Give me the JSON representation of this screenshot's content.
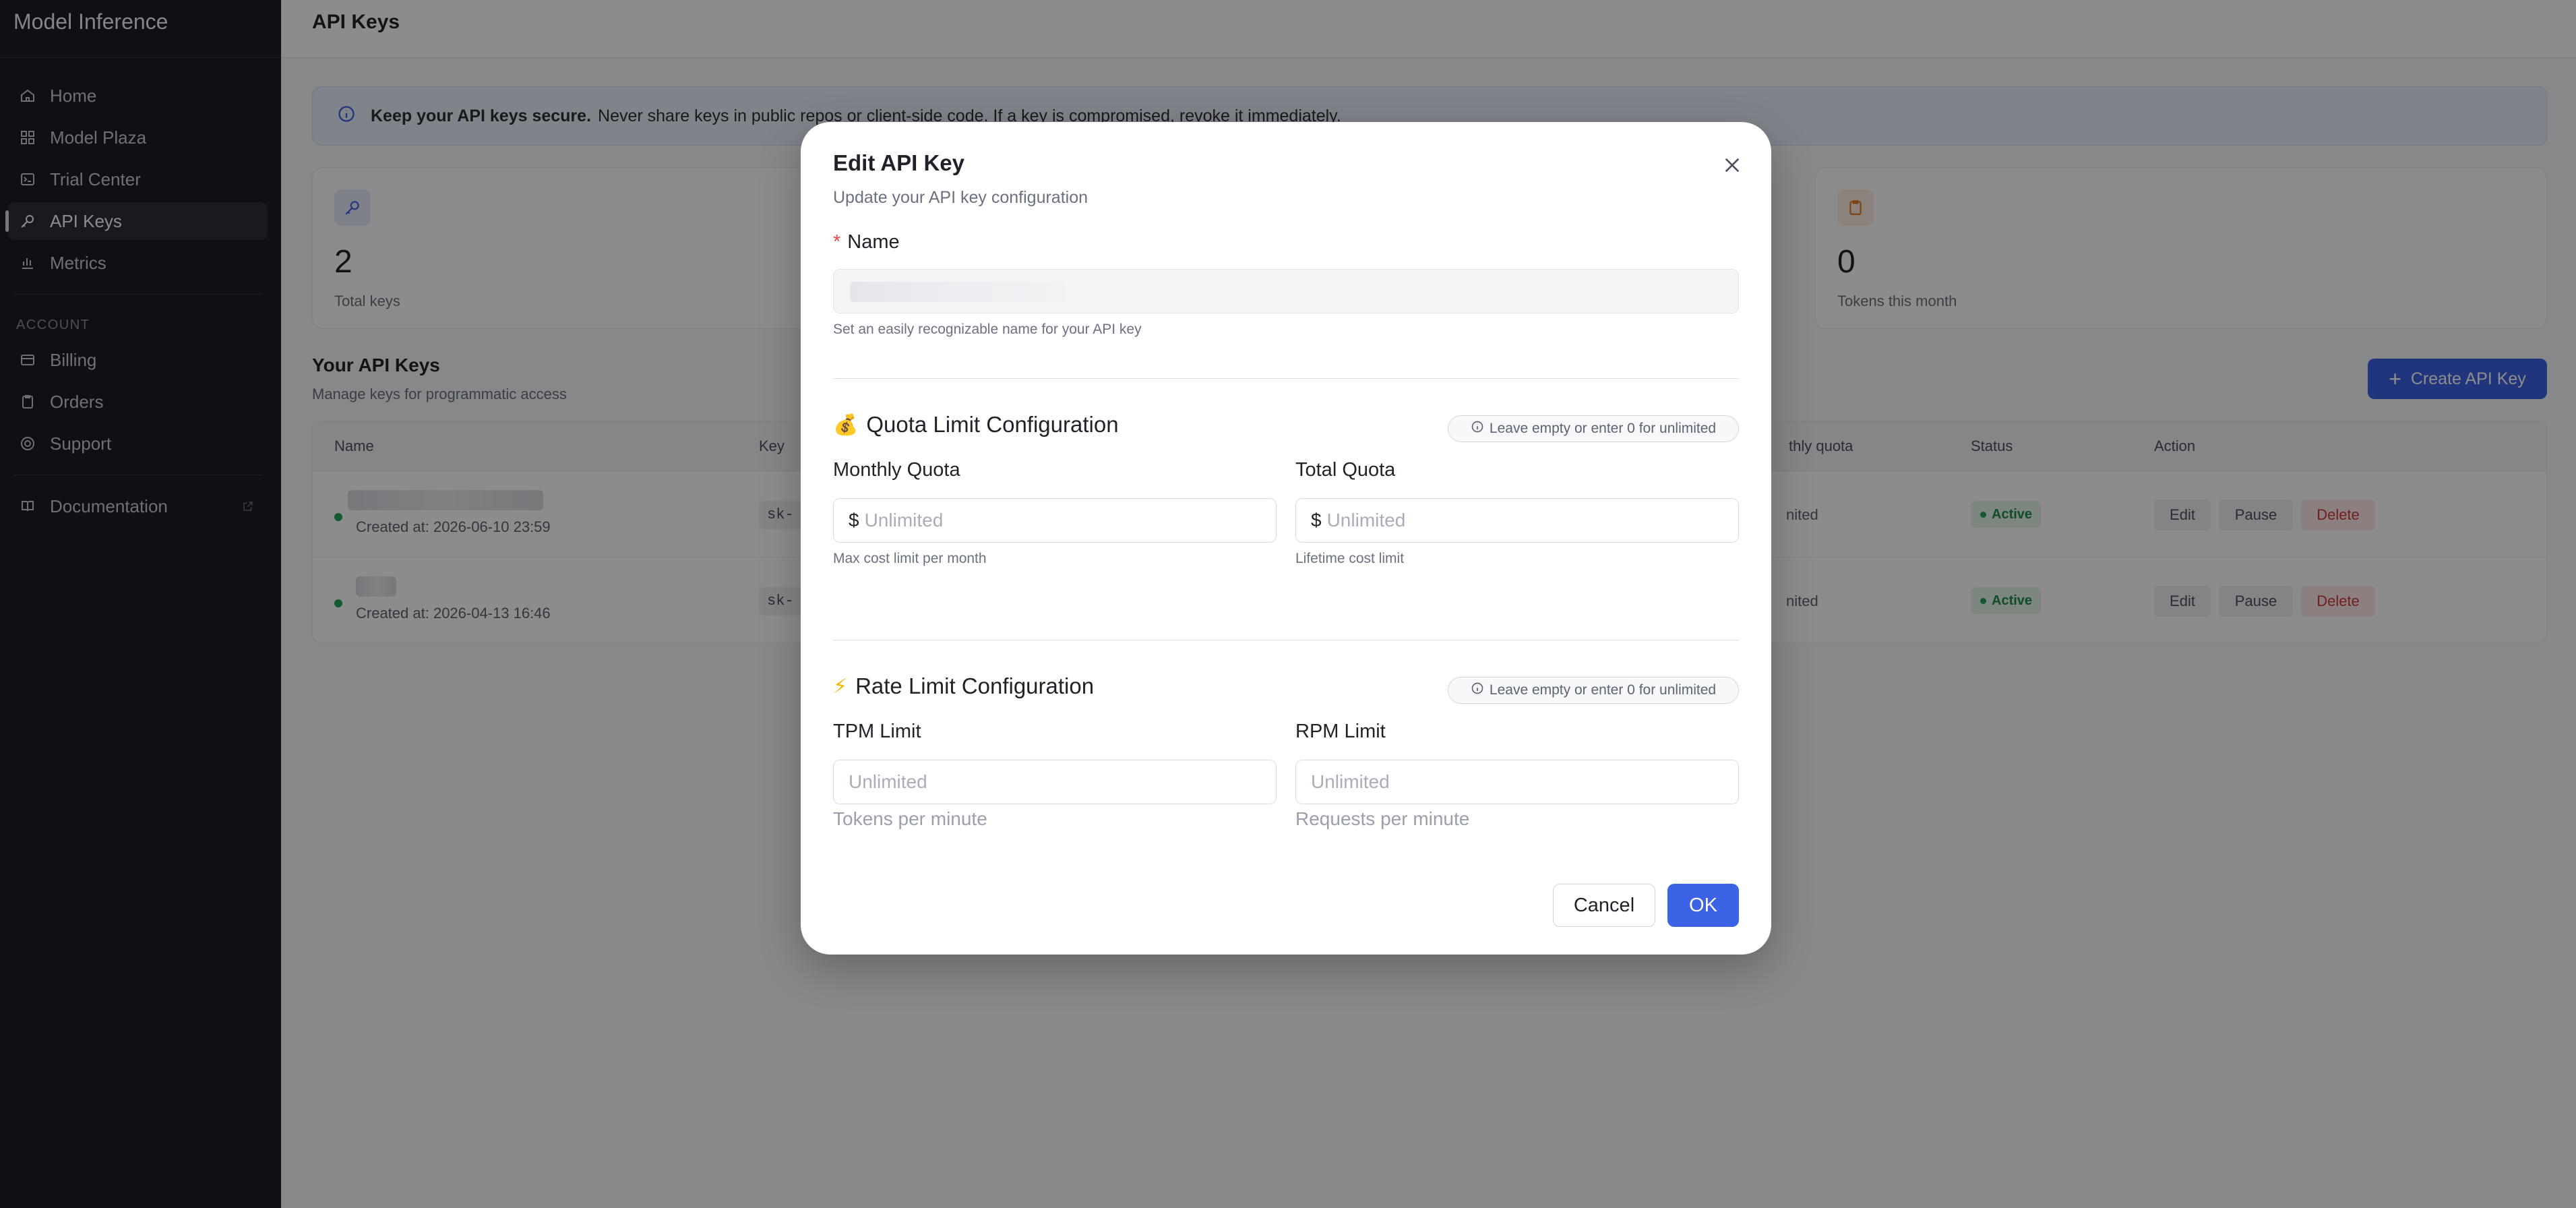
{
  "app": {
    "title": "Model Inference"
  },
  "sidebar": {
    "items": [
      {
        "label": "Home",
        "icon": "home-icon"
      },
      {
        "label": "Model Plaza",
        "icon": "grid-icon"
      },
      {
        "label": "Trial Center",
        "icon": "terminal-icon"
      },
      {
        "label": "API Keys",
        "icon": "key-icon",
        "active": true
      },
      {
        "label": "Metrics",
        "icon": "bar-chart-icon"
      }
    ],
    "account_label": "ACCOUNT",
    "account_items": [
      {
        "label": "Billing",
        "icon": "card-icon"
      },
      {
        "label": "Orders",
        "icon": "clipboard-icon"
      },
      {
        "label": "Support",
        "icon": "lifebuoy-icon"
      }
    ],
    "doc_item": {
      "label": "Documentation",
      "icon": "book-icon"
    }
  },
  "page": {
    "title": "API Keys",
    "banner_bold": "Keep your API keys secure.",
    "banner_text": "Never share keys in public repos or client-side code. If a key is compromised, revoke it immediately.",
    "stats": [
      {
        "value": "2",
        "label": "Total keys"
      },
      {
        "value": "0",
        "label": "Tokens this month"
      }
    ],
    "keys_title": "Your API Keys",
    "keys_subtitle": "Manage keys for programmatic access",
    "create_button": "Create API Key",
    "table": {
      "headers": [
        "Name",
        "Key",
        "thly quota",
        "Status",
        "Action"
      ],
      "rows": [
        {
          "created": "Created at: 2026-06-10 23:59",
          "key": "sk-",
          "quota": "nited",
          "status": "Active"
        },
        {
          "created": "Created at: 2026-04-13 16:46",
          "key": "sk-",
          "quota": "nited",
          "status": "Active"
        }
      ],
      "actions": {
        "edit": "Edit",
        "pause": "Pause",
        "delete": "Delete"
      }
    }
  },
  "modal": {
    "title": "Edit API Key",
    "subtitle": "Update your API key configuration",
    "name_label": "Name",
    "name_required": "*",
    "name_hint": "Set an easily recognizable name for your API key",
    "quota_section": {
      "emoji": "💰",
      "title": "Quota Limit Configuration",
      "pill": "Leave empty or enter 0 for unlimited",
      "monthly_label": "Monthly Quota",
      "monthly_placeholder": "Unlimited",
      "monthly_hint": "Max cost limit per month",
      "total_label": "Total Quota",
      "total_placeholder": "Unlimited",
      "total_hint": "Lifetime cost limit",
      "currency": "$"
    },
    "rate_section": {
      "emoji": "⚡",
      "title": "Rate Limit Configuration",
      "pill": "Leave empty or enter 0 for unlimited",
      "tpm_label": "TPM Limit",
      "tpm_placeholder": "Unlimited",
      "tpm_hint": "Tokens per minute",
      "rpm_label": "RPM Limit",
      "rpm_placeholder": "Unlimited",
      "rpm_hint": "Requests per minute"
    },
    "cancel_label": "Cancel",
    "ok_label": "OK"
  },
  "colors": {
    "accent": "#3c62e6",
    "sidebar_bg": "#1b1e27",
    "active_green": "#23a35a",
    "danger": "#d33a3a"
  }
}
